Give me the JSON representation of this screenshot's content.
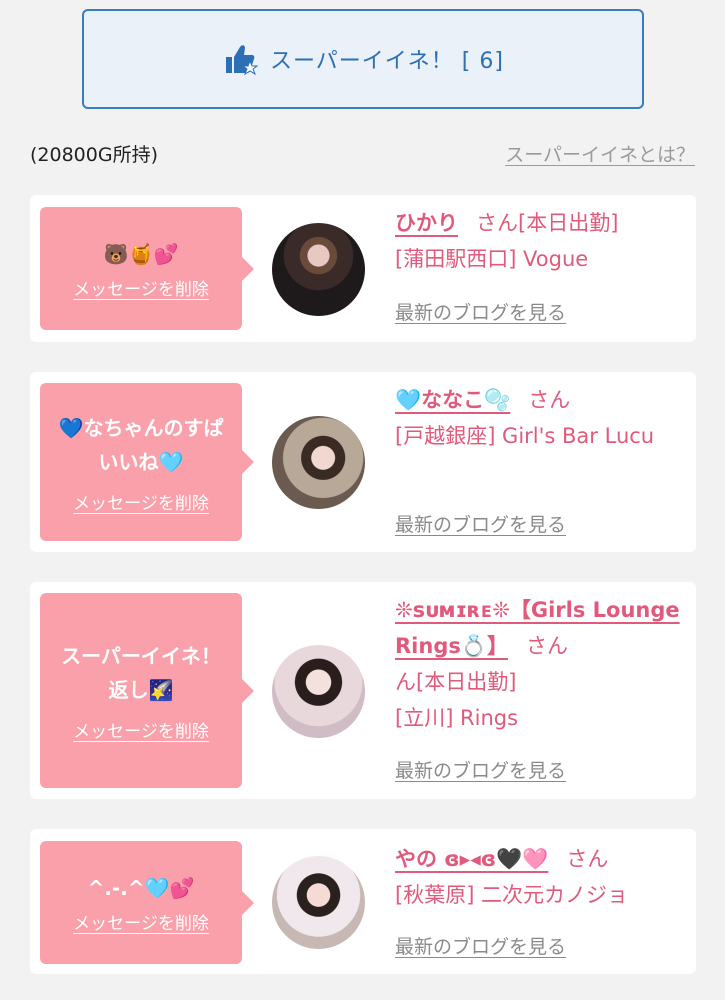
{
  "super_button": {
    "label": "スーパーイイネ！ [ 6]"
  },
  "points": "(20800G所持)",
  "about_link": "スーパーイイネとは？",
  "delete_label": "メッセージを削除",
  "blog_label": "最新のブログを見る",
  "san": "さん",
  "cards": [
    {
      "message": "🐻🍯💕",
      "name": "ひかり",
      "suffix": "[本日出勤]",
      "shop": "[蒲田駅西口] Vogue"
    },
    {
      "message": "💙なちゃんのすぱいいね🩵",
      "name": "🩵ななこ🫧",
      "suffix": "",
      "shop": "[戸越銀座] Girl's Bar Lucu"
    },
    {
      "message": "スーパーイイネ！返し🌠",
      "name": "❊sᴜᴍɪʀᴇ❊【Girls Lounge Rings💍】",
      "suffix": "ん[本日出勤]",
      "shop": "[立川] Rings"
    },
    {
      "message": "^.-.^🩵💕",
      "name": "やの ɞ▸◂ɞ🖤🩷",
      "suffix": "",
      "shop": "[秋葉原] 二次元カノジョ"
    }
  ]
}
